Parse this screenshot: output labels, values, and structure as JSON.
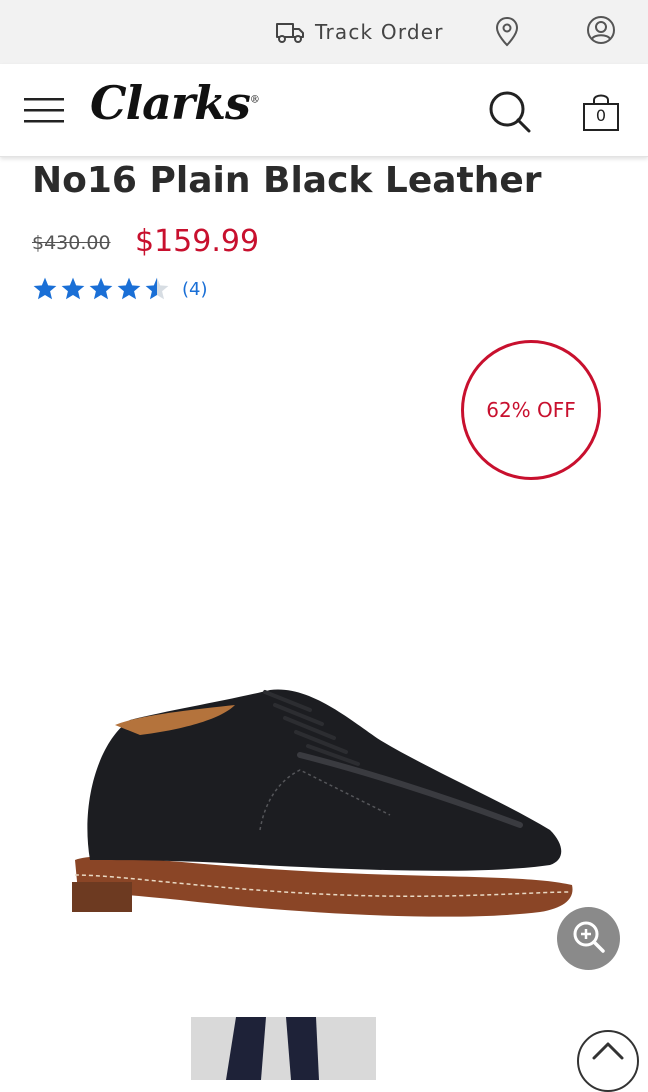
{
  "topbar": {
    "track_order_label": "Track Order"
  },
  "header": {
    "logo_text": "Clarks",
    "logo_mark": "®",
    "bag_count": "0"
  },
  "product": {
    "title": "No16 Plain Black Leather",
    "original_price": "$430.00",
    "sale_price": "$159.99",
    "rating": 4.5,
    "rating_max": 5,
    "review_count": "(4)",
    "discount_badge": "62% OFF"
  },
  "icons": {
    "truck": "truck-icon",
    "location": "location-pin-icon",
    "account": "account-icon",
    "menu": "hamburger-menu-icon",
    "search": "search-icon",
    "bag": "shopping-bag-icon",
    "zoom": "zoom-in-icon",
    "scroll_top": "chevron-up-icon"
  },
  "colors": {
    "sale_red": "#c8102e",
    "star_blue": "#1a6fd6",
    "topbar_bg": "#f2f2f2"
  }
}
